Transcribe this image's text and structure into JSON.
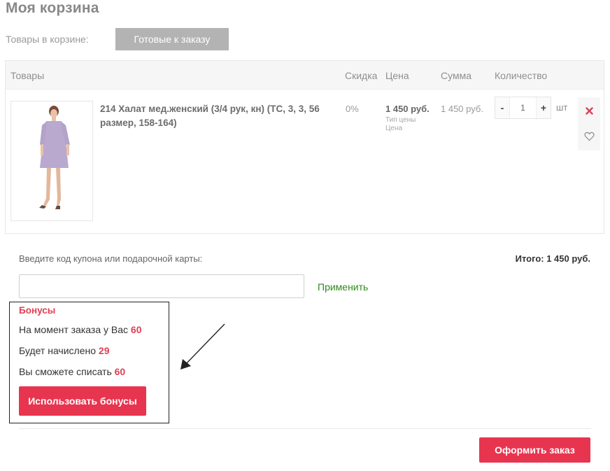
{
  "page": {
    "title": "Моя корзина"
  },
  "tabs": {
    "label": "Товары в корзине:",
    "active": "Готовые к заказу"
  },
  "table": {
    "headers": {
      "goods": "Товары",
      "discount": "Скидка",
      "price": "Цена",
      "sum": "Сумма",
      "quantity": "Количество"
    },
    "rows": [
      {
        "name": "214 Халат мед.женский (3/4 рук, кн) (ТС, 3, 3, 56 размер, 158-164)",
        "discount": "0%",
        "price": "1 450 руб.",
        "price_type": "Тип цены Цена",
        "sum": "1 450 руб.",
        "quantity": "1",
        "unit": "шт",
        "minus": "-",
        "plus": "+"
      }
    ]
  },
  "coupon": {
    "label": "Введите код купона или подарочной карты:",
    "value": "",
    "placeholder": "",
    "apply": "Применить"
  },
  "total": {
    "text": "Итого: 1 450 руб."
  },
  "bonuses": {
    "title": "Бонусы",
    "current_label": "На момент заказа у Вас",
    "current_value": "60",
    "accrue_label": "Будет начислено",
    "accrue_value": "29",
    "spend_label": "Вы сможете списать",
    "spend_value": "60",
    "button": "Использовать бонусы"
  },
  "checkout": {
    "button": "Оформить заказ"
  },
  "colors": {
    "accent": "#e8354f",
    "link": "#2f8a1b",
    "muted": "#888888"
  }
}
